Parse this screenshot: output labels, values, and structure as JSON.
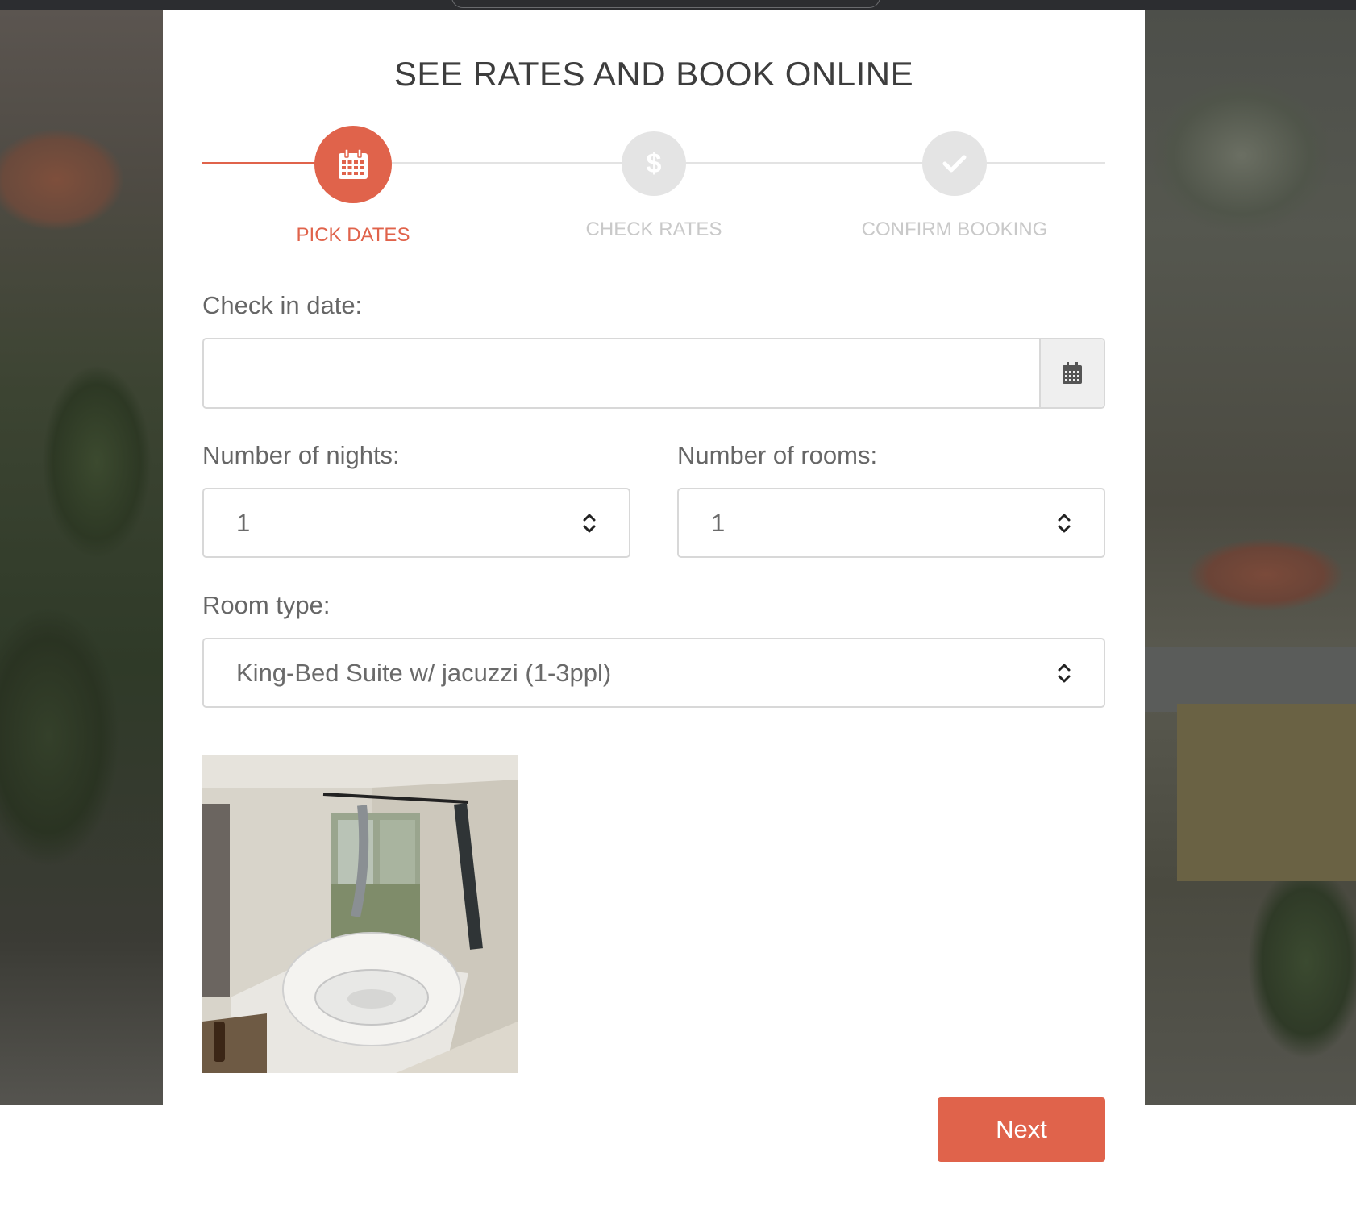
{
  "header": {
    "title": "SEE RATES AND BOOK ONLINE"
  },
  "stepper": {
    "steps": [
      {
        "label": "PICK DATES",
        "icon": "calendar-icon",
        "state": "active"
      },
      {
        "label": "CHECK RATES",
        "icon": "dollar-icon",
        "state": "inactive"
      },
      {
        "label": "CONFIRM BOOKING",
        "icon": "check-icon",
        "state": "inactive"
      }
    ],
    "dollar_glyph": "$"
  },
  "form": {
    "checkin": {
      "label": "Check in date:",
      "value": "",
      "button_icon": "calendar-icon"
    },
    "nights": {
      "label": "Number of nights:",
      "value": "1"
    },
    "rooms": {
      "label": "Number of rooms:",
      "value": "1"
    },
    "room_type": {
      "label": "Room type:",
      "value": "King-Bed Suite w/ jacuzzi (1-3ppl)"
    }
  },
  "room_image": {
    "alt": "room-photo-jacuzzi"
  },
  "actions": {
    "next_label": "Next"
  },
  "colors": {
    "accent": "#e0634b",
    "inactive_step": "#e4e4e4",
    "inactive_text": "#c9c9c9",
    "text": "#3d3d3d"
  }
}
